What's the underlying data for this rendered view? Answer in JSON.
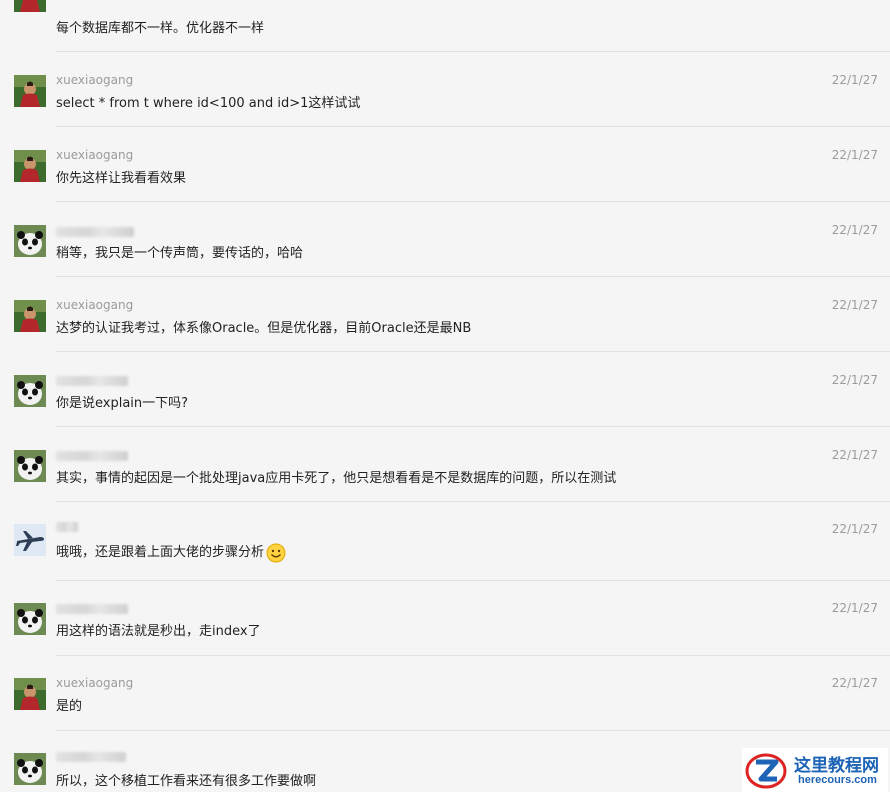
{
  "messages": [
    {
      "name": "",
      "time": "",
      "text": "每个数据库都不一样。优化器不一样",
      "avatar": "person"
    },
    {
      "name": "xuexiaogang",
      "time": "22/1/27",
      "text": "select * from t where id<100 and id>1这样试试",
      "avatar": "person"
    },
    {
      "name": "xuexiaogang",
      "time": "22/1/27",
      "text": "你先这样让我看看效果",
      "avatar": "person"
    },
    {
      "name": "",
      "time": "22/1/27",
      "text": "稍等，我只是一个传声筒，要传话的，哈哈",
      "avatar": "panda"
    },
    {
      "name": "xuexiaogang",
      "time": "22/1/27",
      "text": "达梦的认证我考过，体系像Oracle。但是优化器，目前Oracle还是最NB",
      "avatar": "person"
    },
    {
      "name": "",
      "time": "22/1/27",
      "text": "你是说explain一下吗?",
      "avatar": "panda"
    },
    {
      "name": "",
      "time": "22/1/27",
      "text": "其实，事情的起因是一个批处理java应用卡死了，他只是想看看是不是数据库的问题，所以在测试",
      "avatar": "panda"
    },
    {
      "name": "",
      "time": "22/1/27",
      "text": "哦哦，还是跟着上面大佬的步骤分析",
      "avatar": "plane",
      "emoji": "smile-emoji"
    },
    {
      "name": "",
      "time": "22/1/27",
      "text": "用这样的语法就是秒出，走index了",
      "avatar": "panda"
    },
    {
      "name": "xuexiaogang",
      "time": "22/1/27",
      "text": "是的",
      "avatar": "person"
    },
    {
      "name": "",
      "time": "",
      "text": "所以，这个移植工作看来还有很多工作要做啊",
      "avatar": "panda"
    }
  ],
  "watermark": {
    "title": "这里教程网",
    "url": "herecours.com",
    "logo_icon": "z-logo-icon"
  },
  "colors": {
    "background": "#f5f5f5",
    "text": "#222222",
    "meta": "#9b9b9b",
    "brand": "#1d63b6"
  }
}
